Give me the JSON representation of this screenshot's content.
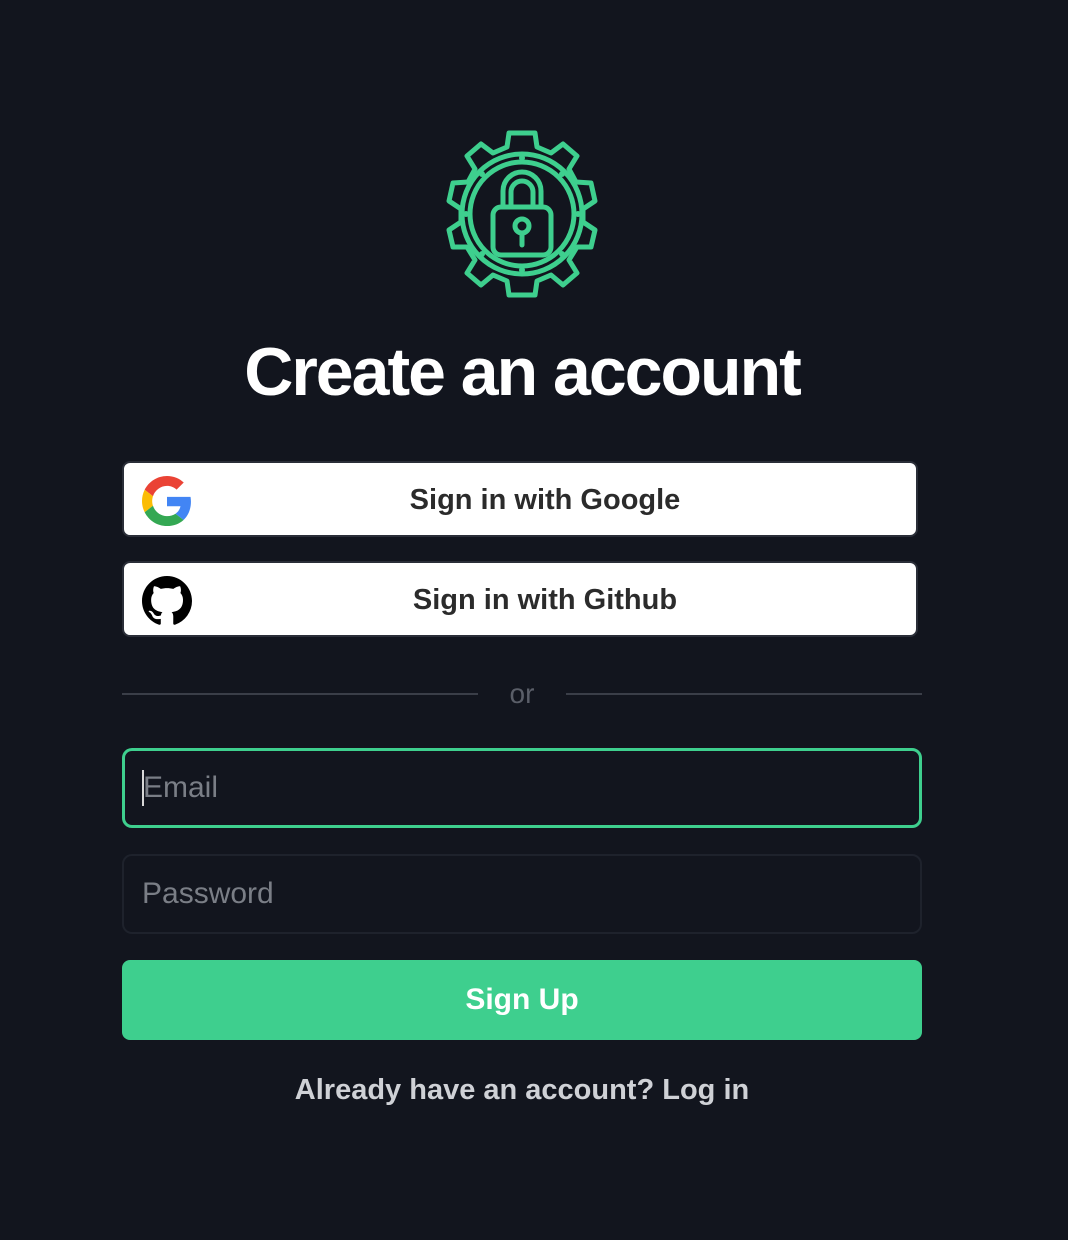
{
  "header": {
    "logo_icon": "gear-lock-icon",
    "title": "Create an account"
  },
  "oauth": {
    "google_label": "Sign in with Google",
    "google_icon": "google-icon",
    "github_label": "Sign in with Github",
    "github_icon": "github-icon"
  },
  "divider": {
    "text": "or"
  },
  "form": {
    "email_placeholder": "Email",
    "email_value": "",
    "password_placeholder": "Password",
    "password_value": "",
    "submit_label": "Sign Up"
  },
  "footer": {
    "login_text": "Already have an account? Log in"
  },
  "colors": {
    "background": "#12151e",
    "accent": "#3ecf8e",
    "white": "#ffffff"
  }
}
